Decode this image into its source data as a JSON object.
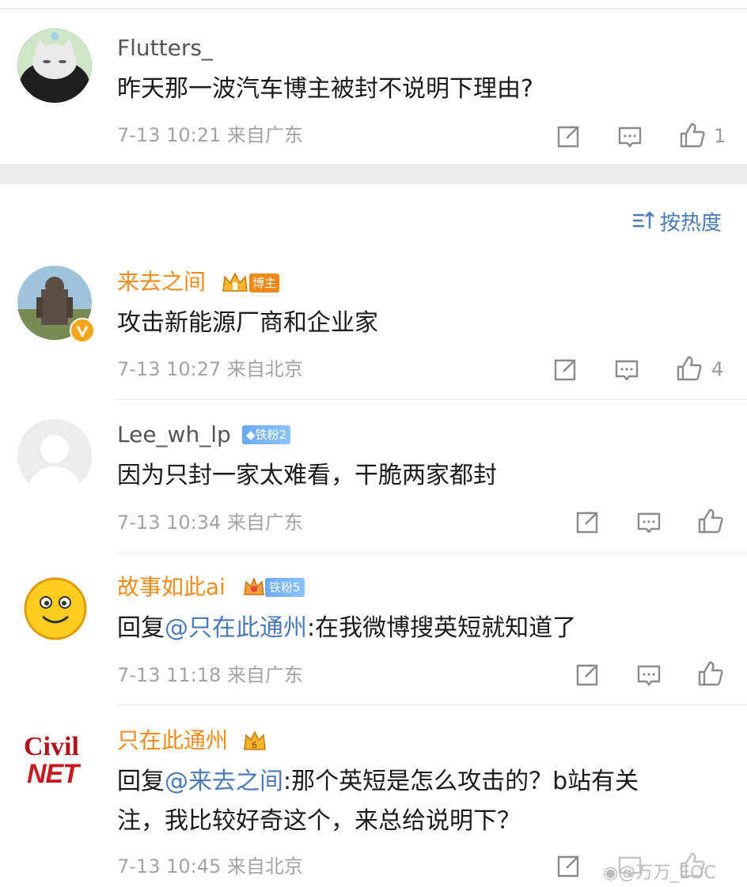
{
  "comments": [
    {
      "user": "Flutters_",
      "text": "昨天那一波汽车博主被封不说明下理由?",
      "time": "7-13 10:21",
      "location": "来自广东",
      "likes": "1"
    },
    {
      "user": "来去之间",
      "badge": "博主",
      "text": "攻击新能源厂商和企业家",
      "time": "7-13 10:27",
      "location": "来自北京",
      "likes": "4",
      "avatar_icon": "verified-badge-icon"
    },
    {
      "user": "Lee_wh_lp",
      "badge": "铁粉2",
      "text": "因为只封一家太难看，干脆两家都封",
      "time": "7-13 10:34",
      "location": "来自广东",
      "likes": ""
    },
    {
      "user": "故事如此ai",
      "badge": "铁粉5",
      "reply_prefix": "回复",
      "mention": "@只在此通州",
      "text": ":在我微博搜英短就知道了",
      "time": "7-13 11:18",
      "location": "来自广东",
      "likes": ""
    },
    {
      "user": "只在此通州",
      "reply_prefix": "回复",
      "mention": "@来去之间",
      "text": ":那个英短是怎么攻击的？b站有关",
      "text2": "注，我比较好奇这个，来总给说明下？",
      "time": "7-13 10:45",
      "location": "来自北京",
      "likes": "",
      "avatar_text1": "Civil",
      "avatar_text2": "NET"
    }
  ],
  "sort": {
    "label": "按热度",
    "icon": "sort-icon"
  },
  "watermark": "@万万_EOC",
  "colors": {
    "link": "#4a7ab8",
    "vip_name": "#f28b1d",
    "meta": "#a3a3a3"
  }
}
